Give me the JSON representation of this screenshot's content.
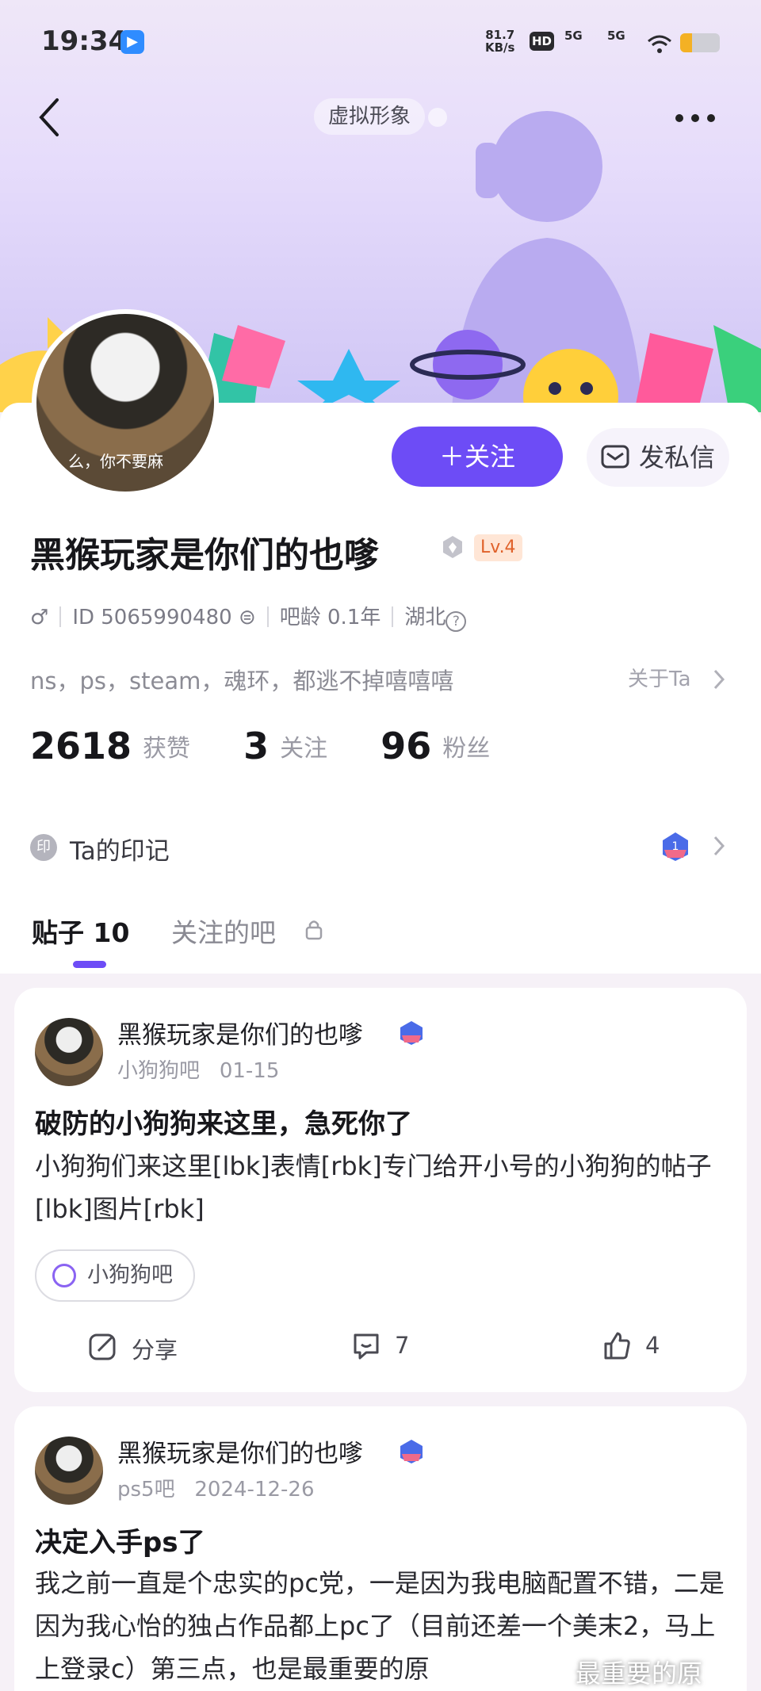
{
  "status_bar": {
    "time": "19:34",
    "net_speed_value": "81.7",
    "net_speed_unit": "KB/s",
    "hd_label": "HD",
    "net1": "5G",
    "net2": "5G",
    "battery_level": 0.3,
    "battery_color": "#f4b124"
  },
  "header": {
    "chip_label": "虚拟形象"
  },
  "profile": {
    "avatar_caption": "么，你不要麻",
    "follow_label": "＋关注",
    "message_label": "发私信",
    "name": "黑猴玩家是你们的也嗲",
    "level": "Lv.4",
    "gender_icon": "male-icon",
    "id_text": "ID 5065990480",
    "bar_age": "吧龄 0.1年",
    "region": "湖北",
    "bio": "ns，ps，steam，魂环，都逃不掉嘻嘻嘻",
    "about_label": "关于Ta",
    "stats": [
      {
        "value": "2618",
        "label": "获赞"
      },
      {
        "value": "3",
        "label": "关注"
      },
      {
        "value": "96",
        "label": "粉丝"
      }
    ],
    "seal_icon_char": "印",
    "seal_label": "Ta的印记"
  },
  "tabs": [
    {
      "label": "贴子 10"
    },
    {
      "label": "关注的吧"
    }
  ],
  "posts": [
    {
      "author": "黑猴玩家是你们的也嗲",
      "bar": "小狗狗吧",
      "date": "01-15",
      "title": "破防的小狗狗来这里，急死你了",
      "body": "小狗狗们来这里[lbk]表情[rbk]专门给开小号的小狗狗的帖子[lbk]图片[rbk]",
      "tag": "小狗狗吧",
      "share_label": "分享",
      "comments": "7",
      "likes": "4"
    },
    {
      "author": "黑猴玩家是你们的也嗲",
      "bar": "ps5吧",
      "date": "2024-12-26",
      "title": "决定入手ps了",
      "body": "我之前一直是个忠实的pc党，一是因为我电脑配置不错，二是因为我心怡的独占作品都上pc了（目前还差一个美末2，马上上登录c）第三点，也是最重要的原"
    }
  ],
  "watermark": "最重要的原",
  "colors": {
    "accent": "#6d4cf6",
    "level_bg": "#ffe6d6",
    "level_fg": "#e0612a"
  }
}
